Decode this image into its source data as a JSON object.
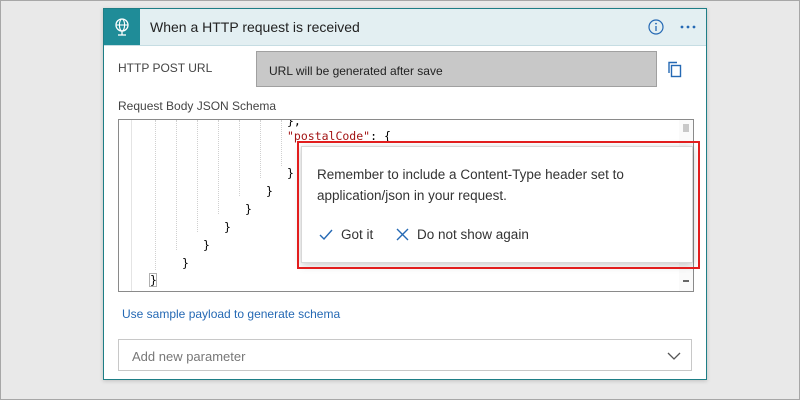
{
  "card": {
    "header_icon": "globe-request-icon",
    "title": "When a HTTP request is received",
    "info_icon": "info-icon",
    "more_icon": "more-options-icon"
  },
  "http_post_url": {
    "label": "HTTP POST URL",
    "value": "URL will be generated after save",
    "copy_icon": "copy-icon"
  },
  "schema": {
    "label": "Request Body JSON Schema",
    "code": {
      "line1": "},",
      "line2_key": "\"postalCode\"",
      "line2_rest": ": {",
      "close": "}"
    }
  },
  "sample_payload_link": "Use sample payload to generate schema",
  "add_parameter": {
    "placeholder": "Add new parameter",
    "chevron_icon": "chevron-down-icon"
  },
  "callout": {
    "message": "Remember to include a Content-Type header set to application/json in your request.",
    "got_it": "Got it",
    "dismiss": "Do not show again",
    "check_icon": "checkmark-icon",
    "close_icon": "close-icon"
  },
  "colors": {
    "accent": "#1f8c98",
    "link": "#2569b4",
    "highlight": "#e21d1d"
  }
}
